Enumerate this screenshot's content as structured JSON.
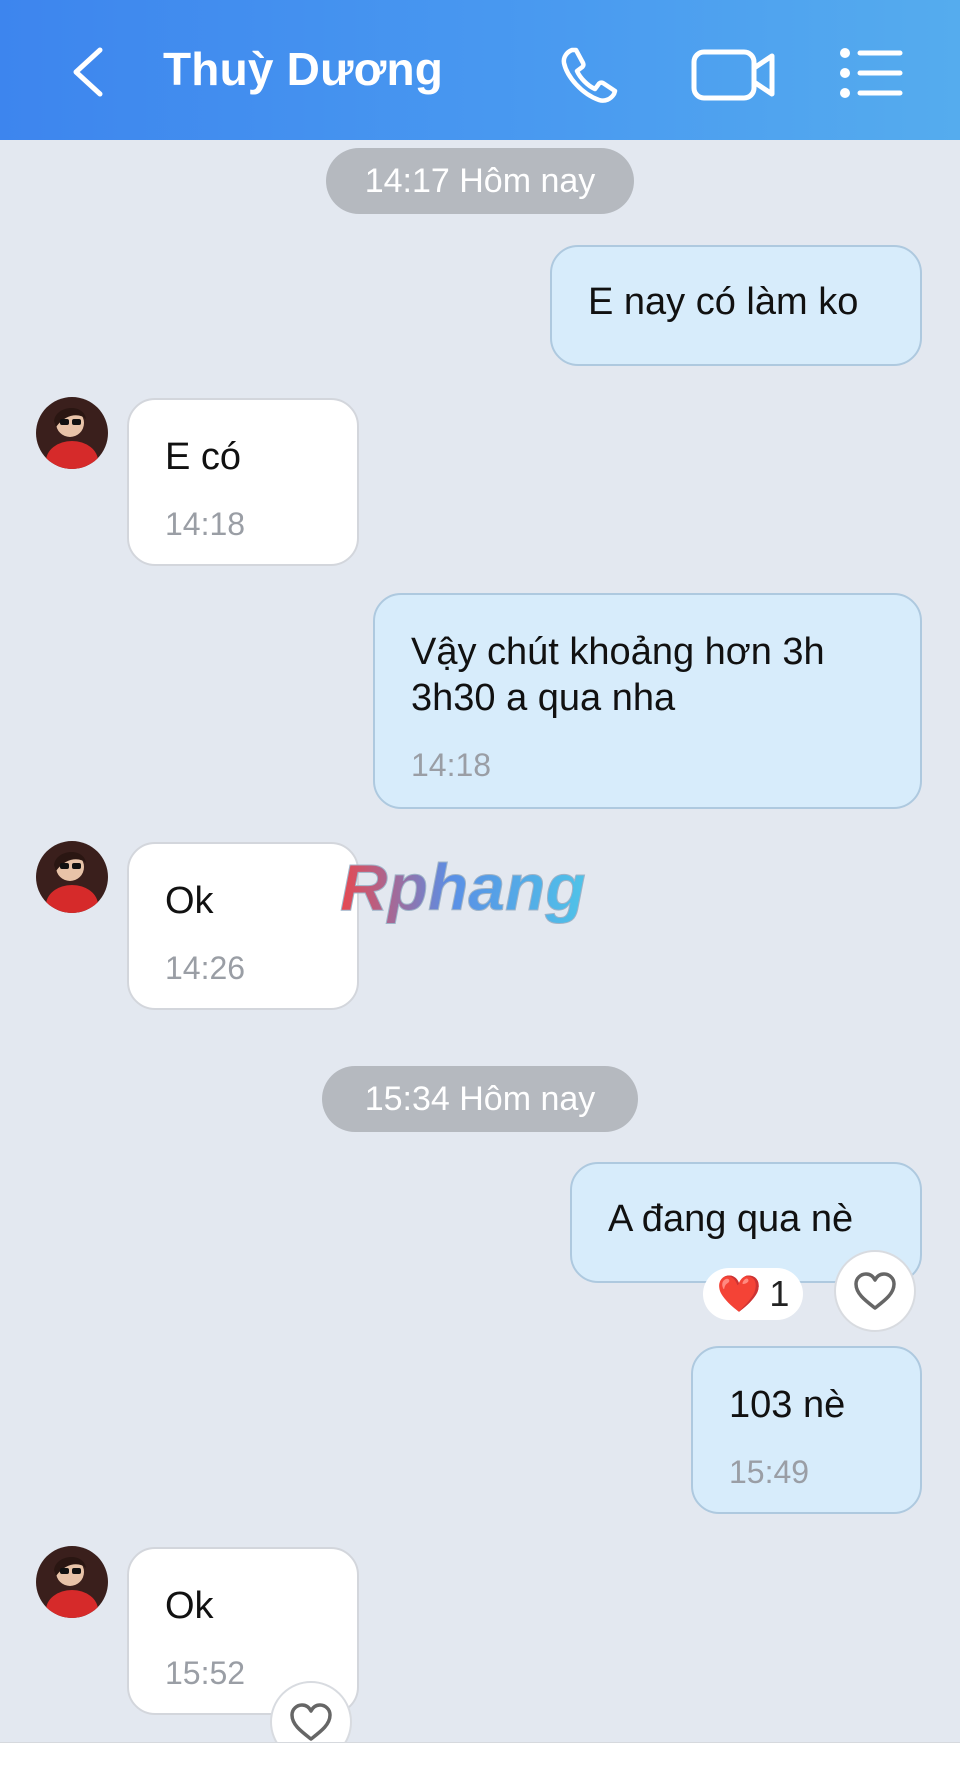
{
  "header": {
    "title": "Thuỳ Dương",
    "icons": [
      "back-chevron-icon",
      "phone-icon",
      "video-camera-icon",
      "menu-list-icon"
    ],
    "color": "#4a9bf0"
  },
  "watermark": "Rphang",
  "dividers": [
    "14:17 Hôm nay",
    "15:34 Hôm nay"
  ],
  "messages": [
    {
      "side": "out",
      "text": "E nay có làm ko",
      "time": ""
    },
    {
      "side": "in",
      "text": "E có",
      "time": "14:18"
    },
    {
      "side": "out",
      "text_line1": "Vậy chút khoảng hơn 3h",
      "text_line2": "3h30 a qua nha",
      "time": "14:18"
    },
    {
      "side": "in",
      "text": "Ok",
      "time": "14:26"
    },
    {
      "side": "out",
      "text": "A đang qua nè",
      "time": ""
    },
    {
      "side": "out",
      "text": "103 nè",
      "time": "15:49"
    },
    {
      "side": "in",
      "text": "Ok",
      "time": "15:52"
    }
  ],
  "reaction": {
    "emoji": "❤️",
    "count": "1"
  }
}
